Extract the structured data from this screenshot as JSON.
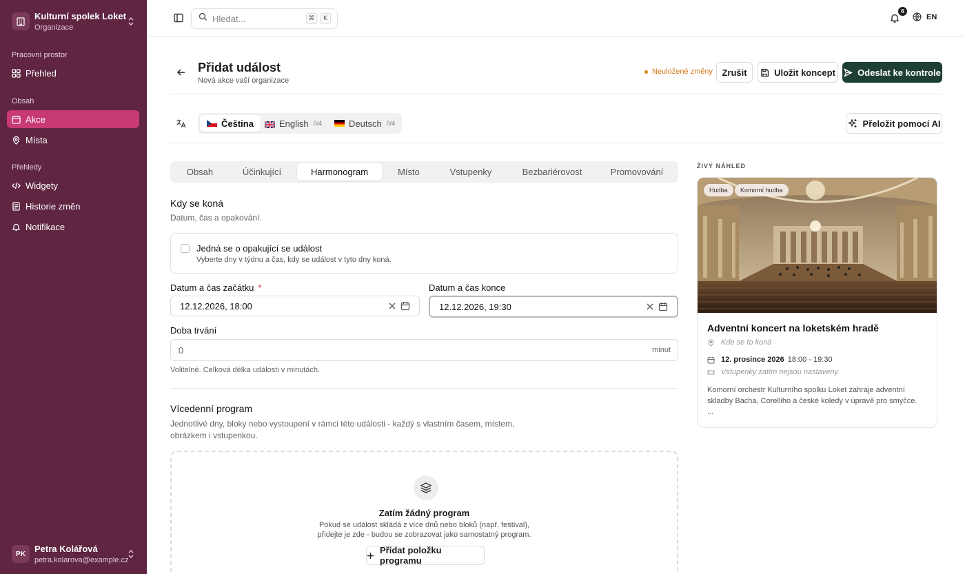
{
  "org": {
    "name": "Kulturní spolek Loket",
    "type": "Organizace"
  },
  "nav": {
    "workspace_label": "Pracovní prostor",
    "overview": "Přehled",
    "content_label": "Obsah",
    "events": "Akce",
    "places": "Místa",
    "reports_label": "Přehledy",
    "widgets": "Widgety",
    "history": "Historie změn",
    "notifications": "Notifikace"
  },
  "user": {
    "initials": "PK",
    "name": "Petra Kolářová",
    "email": "petra.kolarova@example.cz"
  },
  "topbar": {
    "search_placeholder": "Hledat...",
    "kbd1": "⌘",
    "kbd2": "K",
    "notif_count": "6",
    "lang": "EN"
  },
  "page": {
    "title": "Přidat událost",
    "subtitle": "Nová akce vaší organizace",
    "unsaved": "Neuložené změny",
    "cancel": "Zrušit",
    "save_draft": "Uložit koncept",
    "submit": "Odeslat ke kontrole"
  },
  "languages": [
    {
      "name": "Čeština",
      "count": ""
    },
    {
      "name": "English",
      "count": "0/4"
    },
    {
      "name": "Deutsch",
      "count": "0/4"
    }
  ],
  "ai_translate": "Přeložit pomocí AI",
  "tabs": [
    "Obsah",
    "Účinkující",
    "Harmonogram",
    "Místo",
    "Vstupenky",
    "Bezbariérovost",
    "Promovování"
  ],
  "active_tab": "Harmonogram",
  "when": {
    "title": "Kdy se koná",
    "desc": "Datum, čas a opakování.",
    "recurring_title": "Jedná se o opakující se událost",
    "recurring_desc": "Vyberte dny v týdnu a čas, kdy se událost v tyto dny koná.",
    "recurring_checked": false,
    "start_label": "Datum a čas začátku",
    "required_mark": "*",
    "start_value": "12.12.2026, 18:00",
    "end_label": "Datum a čas konce",
    "end_value": "12.12.2026, 19:30",
    "duration_label": "Doba trvání",
    "duration_placeholder": "0",
    "duration_unit": "minut",
    "duration_help": "Volitelné. Celková délka události v minutách."
  },
  "program": {
    "title": "Vícedenní program",
    "desc": "Jednotlivé dny, bloky nebo vystoupení v rámci této události - každý s vlastním časem, místem, obrázkem i vstupenkou.",
    "empty_title": "Zatím žádný program",
    "empty_desc": "Pokud se událost skládá z více dnů nebo bloků (např. festival), přidejte je zde - budou se zobrazovat jako samostatný program.",
    "add_button": "Přidat položku programu"
  },
  "preview": {
    "label": "ŽIVÝ NÁHLED",
    "tags": [
      "Hudba",
      "Komorní hudba"
    ],
    "title": "Adventní koncert na loketském hradě",
    "place": "Kde se to koná",
    "date": "12. prosince 2026",
    "time": "18:00 - 19:30",
    "tickets": "Vstupenky zatím nejsou nastaveny.",
    "description": "Komorní orchestr Kulturního spolku Loket zahraje adventní skladby Bacha, Corelliho a české koledy v úpravě pro smyčce.",
    "ellipsis": "..."
  },
  "colors": {
    "sidebar": "#5f2541",
    "active_nav": "#c83a74",
    "primary_button": "#1d3f34",
    "warning": "#e08418"
  }
}
